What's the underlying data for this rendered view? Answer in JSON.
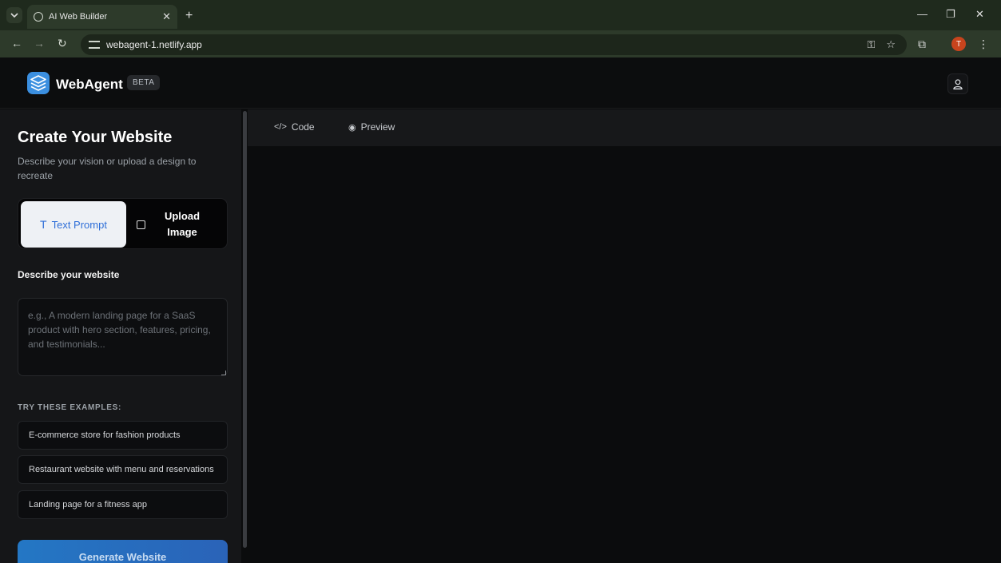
{
  "browser": {
    "tab_title": "AI Web Builder",
    "url": "webagent-1.netlify.app",
    "new_tab": "+",
    "profile_initial": "T"
  },
  "header": {
    "brand": "WebAgent",
    "badge": "BETA"
  },
  "sidebar": {
    "title": "Create Your Website",
    "subtitle": "Describe your vision or upload a design to recreate",
    "modes": {
      "text": "Text Prompt",
      "upload": "Upload Image",
      "selected": "text"
    },
    "field_label": "Describe your website",
    "prompt_placeholder": "e.g., A modern landing page for a SaaS product with hero section, features, pricing, and testimonials...",
    "prompt_value": "",
    "examples_heading": "TRY THESE EXAMPLES:",
    "examples": [
      "E-commerce store for fashion products",
      "Restaurant website with menu and reservations",
      "Landing page for a fitness app"
    ],
    "generate_label": "Generate Website"
  },
  "main": {
    "tabs": [
      "Code",
      "Preview"
    ]
  },
  "colors": {
    "accent": "#2f6fd8",
    "generate_gradient_start": "#2477c4",
    "generate_gradient_end": "#2a63b8",
    "profile": "#c7441d"
  }
}
